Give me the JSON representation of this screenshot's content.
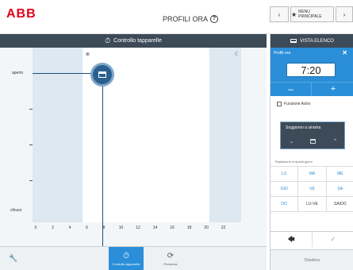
{
  "header": {
    "logo": "ABB",
    "title": "PROFILI ORA",
    "help_icon": "?",
    "prev_icon": "chevron-left-icon",
    "next_icon": "chevron-right-icon",
    "menu_label": "MENU PRINCIPALE"
  },
  "left_panel": {
    "title": "Controllo tapparelle",
    "title_icon": "stopwatch-icon",
    "y_top_label": "aperto",
    "y_bottom_label": "chiuso",
    "x_ticks": [
      "0",
      "2",
      "4",
      "6",
      "8",
      "10",
      "12",
      "14",
      "16",
      "18",
      "20",
      "22"
    ]
  },
  "chart_data": {
    "type": "line",
    "x": [
      7.2,
      24
    ],
    "y": [
      "aperto",
      "aperto"
    ],
    "xlim": [
      0,
      24
    ],
    "yticks": [
      "aperto",
      "chiuso"
    ],
    "xticks": [
      0,
      2,
      4,
      6,
      8,
      10,
      12,
      14,
      16,
      18,
      20,
      22
    ]
  },
  "bottom_bar": {
    "tabs": [
      {
        "label": "Controllo tapparelle",
        "icon": "stopwatch-icon",
        "active": true
      },
      {
        "label": "Presenza",
        "icon": "presence-clock-icon",
        "active": false
      }
    ]
  },
  "right_panel": {
    "view_list_label": "VISTA ELENCO",
    "profile_title": "Profili ora",
    "time_value": "7:20",
    "minus_label": "–",
    "plus_label": "+",
    "astro_label": "Funzione Astro",
    "room_label": "Soggiorno a sinistra",
    "repeat_label": "Ripetizione in questi giorni",
    "days": [
      [
        "LU",
        "MA",
        "ME"
      ],
      [
        "GIO",
        "VE",
        "SA"
      ],
      [
        "DO",
        "LU-VE",
        "SA/DO"
      ]
    ],
    "disable_label": "Disattiva"
  }
}
